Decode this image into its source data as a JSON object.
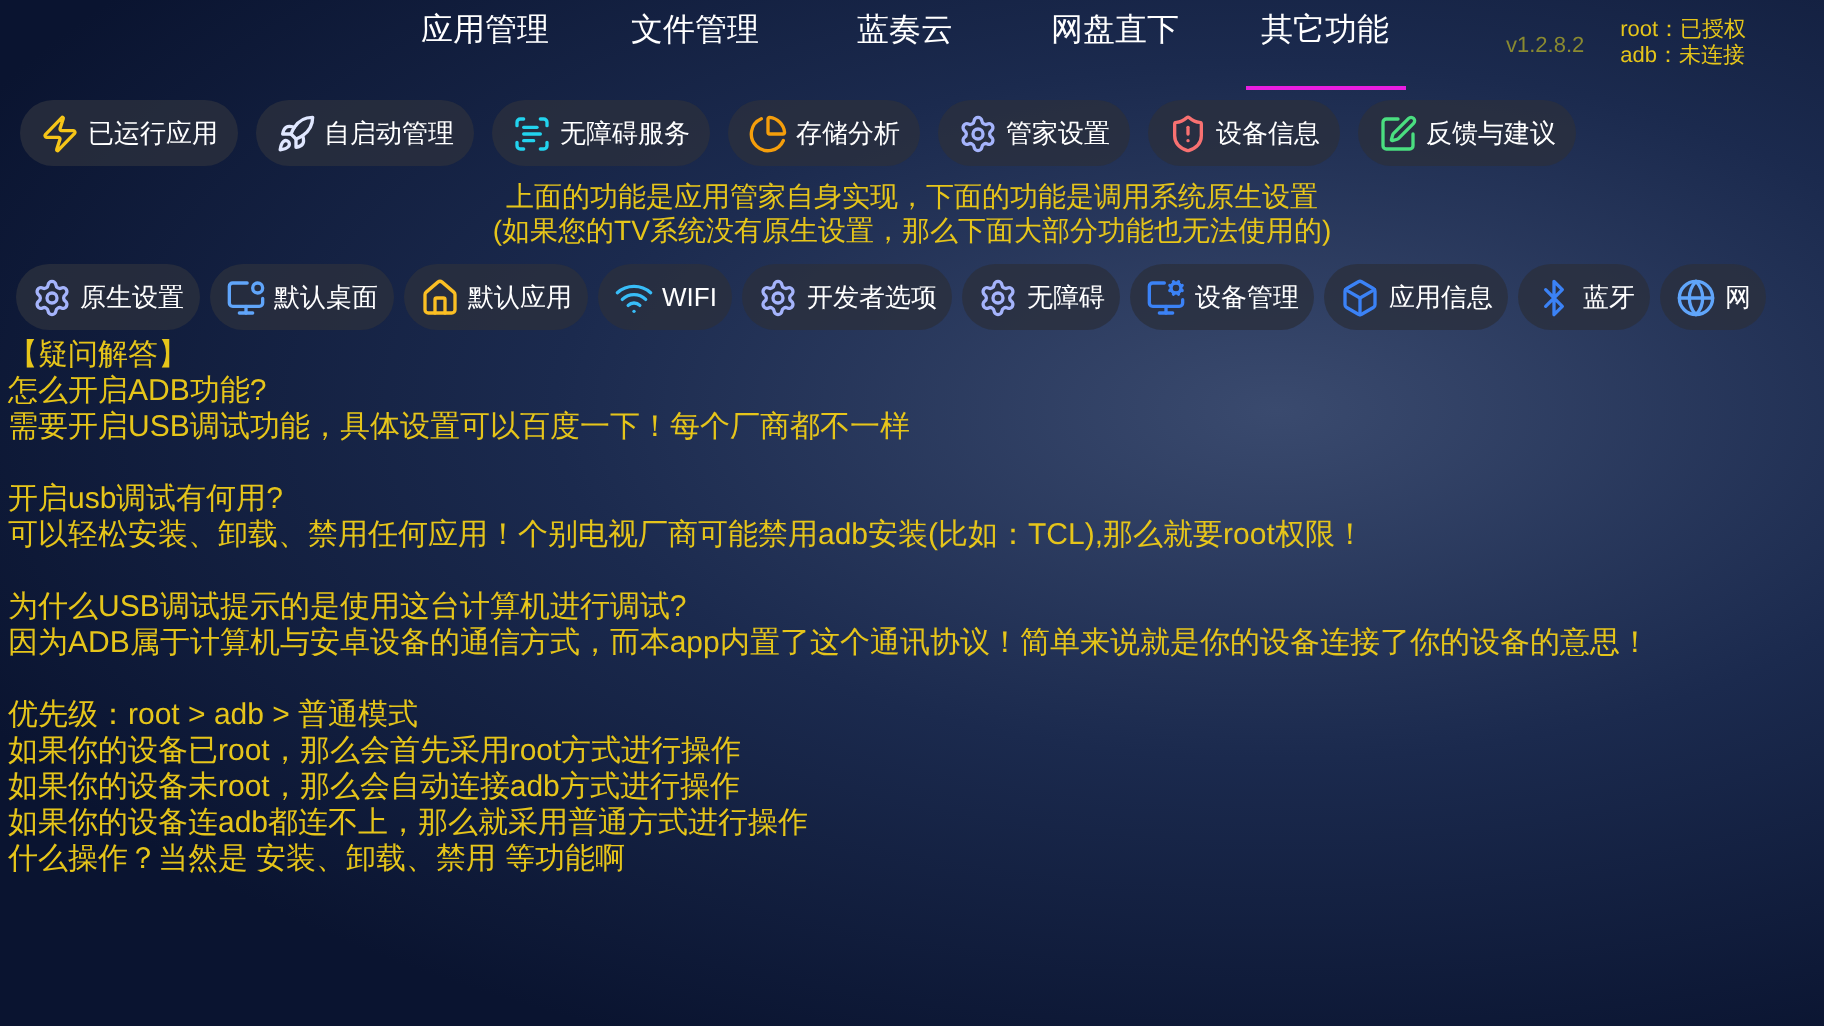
{
  "tabs": [
    {
      "label": "应用管理",
      "selected": false
    },
    {
      "label": "文件管理",
      "selected": false
    },
    {
      "label": "蓝奏云",
      "selected": false
    },
    {
      "label": "网盘直下",
      "selected": false
    },
    {
      "label": "其它功能",
      "selected": true
    }
  ],
  "version": "v1.2.8.2",
  "status": [
    "root：已授权",
    "adb：未连接"
  ],
  "app_tools": [
    {
      "kind": "bolt",
      "label": "已运行应用"
    },
    {
      "kind": "rocket",
      "label": "自启动管理"
    },
    {
      "kind": "ai",
      "label": "无障碍服务"
    },
    {
      "kind": "pie",
      "label": "存储分析"
    },
    {
      "kind": "gear",
      "label": "管家设置"
    },
    {
      "kind": "shield",
      "label": "设备信息"
    },
    {
      "kind": "edit",
      "label": "反馈与建议"
    }
  ],
  "notice": [
    "上面的功能是应用管家自身实现，下面的功能是调用系统原生设置",
    "(如果您的TV系统没有原生设置，那么下面大部分功能也无法使用的)"
  ],
  "system_tools": [
    {
      "kind": "gear",
      "label": "原生设置"
    },
    {
      "kind": "desktop",
      "label": "默认桌面"
    },
    {
      "kind": "home",
      "label": "默认应用"
    },
    {
      "kind": "wifi",
      "label": "WIFI"
    },
    {
      "kind": "gear",
      "label": "开发者选项"
    },
    {
      "kind": "gear",
      "label": "无障碍"
    },
    {
      "kind": "monitor",
      "label": "设备管理"
    },
    {
      "kind": "box",
      "label": "应用信息"
    },
    {
      "kind": "bluetooth",
      "label": "蓝牙"
    },
    {
      "kind": "globe",
      "label": "网"
    }
  ],
  "faq": {
    "title": "【疑问解答】",
    "sections": [
      [
        "怎么开启ADB功能?",
        "需要开启USB调试功能，具体设置可以百度一下！每个厂商都不一样"
      ],
      [
        "开启usb调试有何用?",
        "可以轻松安装、卸载、禁用任何应用！个别电视厂商可能禁用adb安装(比如：TCL),那么就要root权限！"
      ],
      [
        "为什么USB调试提示的是使用这台计算机进行调试?",
        "因为ADB属于计算机与安卓设备的通信方式，而本app内置了这个通讯协议！简单来说就是你的设备连接了你的设备的意思！"
      ],
      [
        "优先级：root > adb > 普通模式",
        "如果你的设备已root，那么会首先采用root方式进行操作",
        "如果你的设备未root，那么会自动连接adb方式进行操作",
        "如果你的设备连adb都连不上，那么就采用普通方式进行操作",
        "什么操作？当然是 安装、卸载、禁用 等功能啊"
      ]
    ]
  }
}
